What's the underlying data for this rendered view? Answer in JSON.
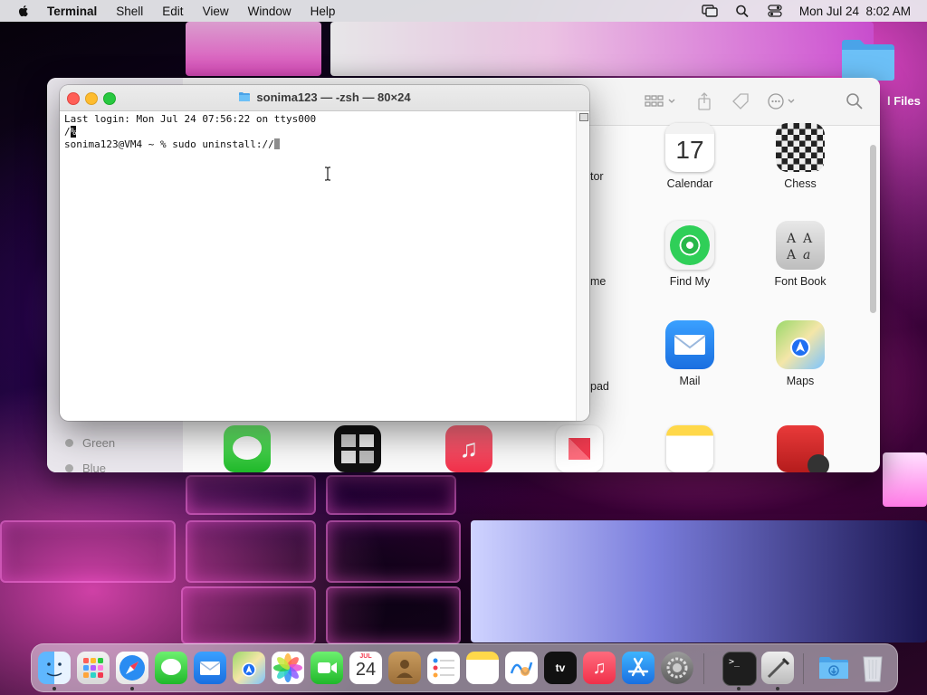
{
  "menubar": {
    "app_name": "Terminal",
    "items": [
      "Shell",
      "Edit",
      "View",
      "Window",
      "Help"
    ],
    "clock": "Mon Jul 24  8:02 AM",
    "status_icons": [
      "screen-mirroring-icon",
      "search-icon",
      "control-center-icon"
    ]
  },
  "desktop": {
    "folder_label": "l Files"
  },
  "finder": {
    "tags": [
      "Green",
      "Blue"
    ],
    "apps": [
      {
        "name": "Calendar",
        "icon": "calendar-icon",
        "date": "17"
      },
      {
        "name": "Chess",
        "icon": "chess-icon"
      },
      {
        "name": "Find My",
        "icon": "find-my-icon"
      },
      {
        "name": "Font Book",
        "icon": "font-book-icon"
      },
      {
        "name": "Mail",
        "icon": "mail-icon"
      },
      {
        "name": "Maps",
        "icon": "maps-icon"
      }
    ],
    "cut_labels": [
      "tor",
      "me",
      "pad"
    ],
    "bottom_row_icons": [
      "messages-icon",
      "mission-control-icon",
      "music-icon",
      "news-icon",
      "notes-icon",
      "photo-booth-icon"
    ]
  },
  "terminal": {
    "title": "sonima123 — -zsh — 80×24",
    "line1": "Last login: Mon Jul 24 07:56:22 on ttys000",
    "line2_prefix": "/",
    "line2_mark": "%",
    "line3": "sonima123@VM4 ~ % sudo uninstall://"
  },
  "dock": {
    "calendar_month": "JUL",
    "calendar_day": "24",
    "apps": [
      "finder-icon",
      "launchpad-icon",
      "safari-icon",
      "messages-icon",
      "mail-icon",
      "maps-icon",
      "photos-icon",
      "facetime-icon",
      "calendar-icon",
      "contacts-icon",
      "reminders-icon",
      "notes-icon",
      "freeform-icon",
      "apple-tv-icon",
      "music-icon",
      "app-store-icon",
      "system-settings-icon",
      "terminal-icon",
      "script-editor-icon",
      "downloads-folder-icon",
      "trash-icon"
    ]
  },
  "colors": {
    "close": "#ff5f57",
    "minimize": "#febc2e",
    "zoom": "#28c840"
  }
}
